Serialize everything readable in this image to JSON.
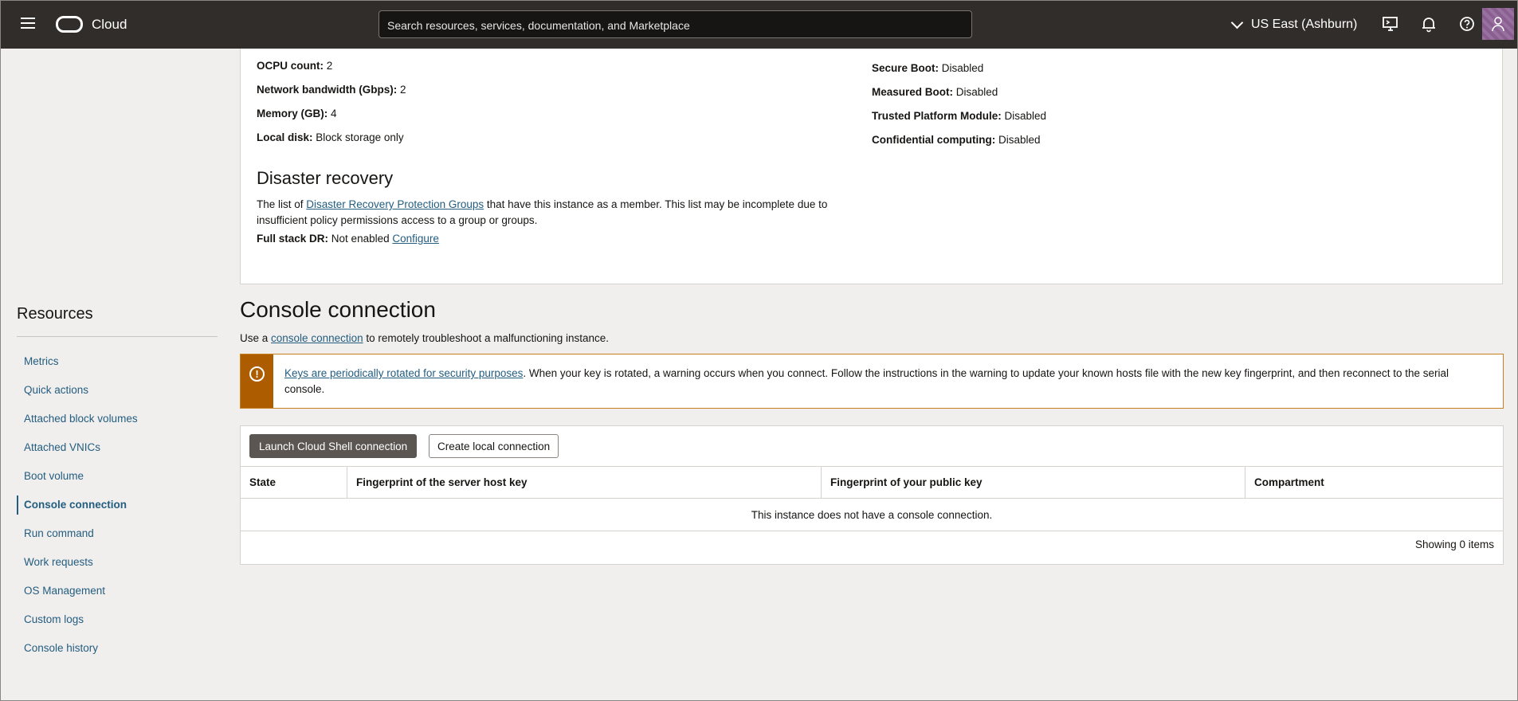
{
  "topbar": {
    "brand": "Cloud",
    "search_placeholder": "Search resources, services, documentation, and Marketplace",
    "region": "US East (Ashburn)"
  },
  "details": {
    "left": [
      {
        "key": "OCPU count:",
        "value": "2"
      },
      {
        "key": "Network bandwidth (Gbps):",
        "value": "2"
      },
      {
        "key": "Memory (GB):",
        "value": "4"
      },
      {
        "key": "Local disk:",
        "value": "Block storage only"
      }
    ],
    "right": [
      {
        "key": "Secure Boot:",
        "value": "Disabled"
      },
      {
        "key": "Measured Boot:",
        "value": "Disabled"
      },
      {
        "key": "Trusted Platform Module:",
        "value": "Disabled"
      },
      {
        "key": "Confidential computing:",
        "value": "Disabled"
      }
    ]
  },
  "disaster_recovery": {
    "title": "Disaster recovery",
    "text_prefix": "The list of ",
    "link": "Disaster Recovery Protection Groups",
    "text_suffix": " that have this instance as a member. This list may be incomplete due to insufficient policy permissions access to a group or groups.",
    "full_stack_label": "Full stack DR:",
    "full_stack_value": "Not enabled",
    "configure_link": "Configure"
  },
  "sidebar": {
    "title": "Resources",
    "items": [
      {
        "label": "Metrics"
      },
      {
        "label": "Quick actions"
      },
      {
        "label": "Attached block volumes"
      },
      {
        "label": "Attached VNICs"
      },
      {
        "label": "Boot volume"
      },
      {
        "label": "Console connection",
        "active": true
      },
      {
        "label": "Run command"
      },
      {
        "label": "Work requests"
      },
      {
        "label": "OS Management"
      },
      {
        "label": "Custom logs"
      },
      {
        "label": "Console history"
      }
    ]
  },
  "console": {
    "title": "Console connection",
    "desc_prefix": "Use a ",
    "desc_link": "console connection",
    "desc_suffix": " to remotely troubleshoot a malfunctioning instance.",
    "warning_link": "Keys are periodically rotated for security purposes",
    "warning_text": ". When your key is rotated, a warning occurs when you connect. Follow the instructions in the warning to update your known hosts file with the new key fingerprint, and then reconnect to the serial console.",
    "launch_button": "Launch Cloud Shell connection",
    "create_button": "Create local connection",
    "columns": [
      "State",
      "Fingerprint of the server host key",
      "Fingerprint of your public key",
      "Compartment"
    ],
    "empty_message": "This instance does not have a console connection.",
    "item_count": "Showing 0 items"
  },
  "colors": {
    "topbar": "#312d2a",
    "link": "#235d80",
    "warning": "#ad5d00",
    "avatar": "#8a5e91"
  }
}
